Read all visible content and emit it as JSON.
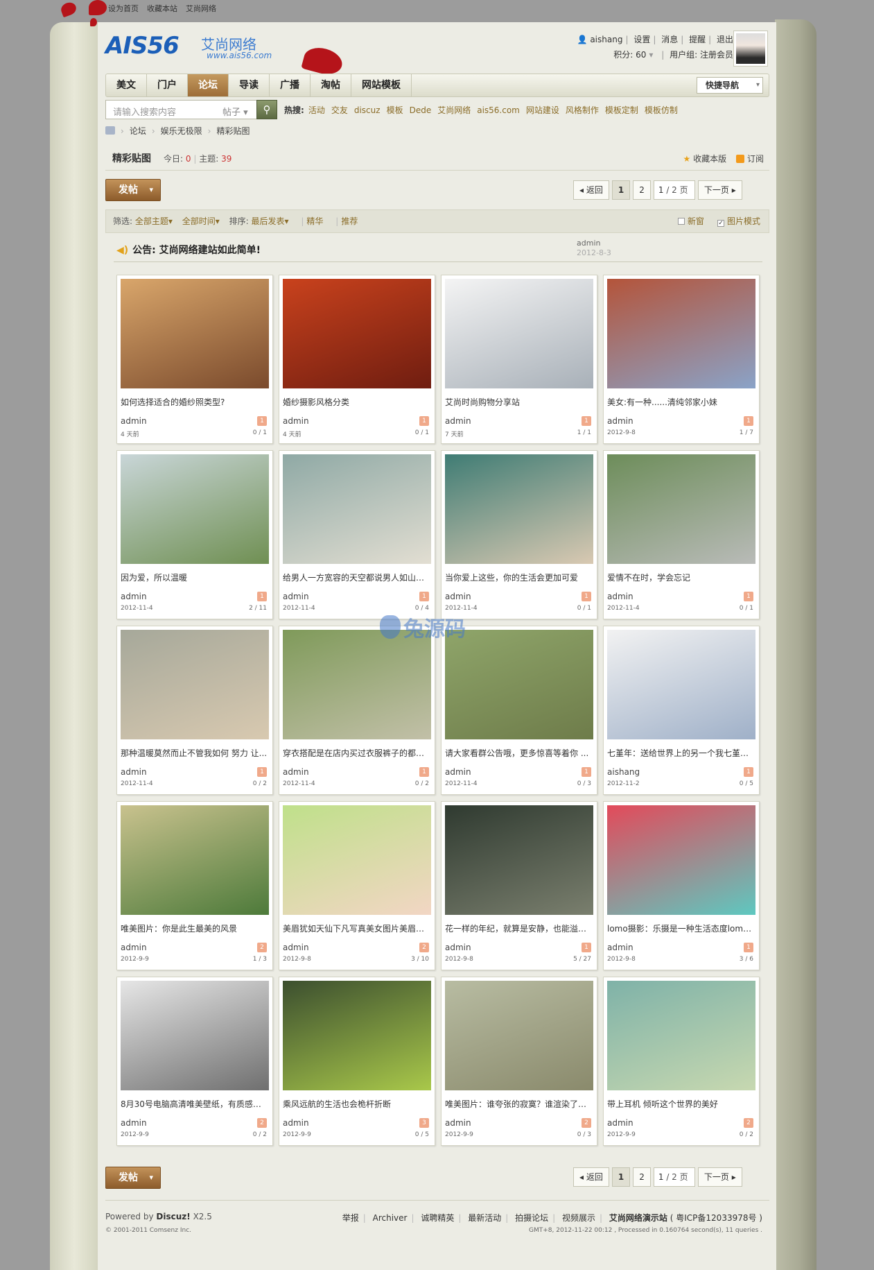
{
  "topbar": {
    "links": [
      "设为首页",
      "收藏本站",
      "艾尚网络"
    ]
  },
  "logo": {
    "mark": "AIS56",
    "cn": "艾尚网络",
    "url": "www.ais56.com"
  },
  "user": {
    "name": "aishang",
    "links": [
      "设置",
      "消息",
      "提醒",
      "退出"
    ],
    "points": "积分: 60",
    "group": "用户组: 注册会员"
  },
  "nav": {
    "items": [
      "美文",
      "门户",
      "论坛",
      "导读",
      "广播",
      "淘帖",
      "网站模板"
    ],
    "active": 2,
    "quick": "快捷导航"
  },
  "search": {
    "placeholder": "请输入搜索内容",
    "type": "帖子"
  },
  "hot": {
    "label": "热搜:",
    "items": [
      "活动",
      "交友",
      "discuz",
      "模板",
      "Dede",
      "艾尚网络",
      "ais56.com",
      "网站建设",
      "风格制作",
      "模板定制",
      "模板仿制"
    ]
  },
  "breadcrumb": [
    "论坛",
    "娱乐无极限",
    "精彩贴图"
  ],
  "forum": {
    "name": "精彩贴图",
    "today_label": "今日:",
    "today": "0",
    "topics_label": "主题:",
    "topics": "39",
    "fav": "收藏本版",
    "rss": "订阅"
  },
  "post_label": "发帖",
  "pager": {
    "back": "返回",
    "pages": [
      "1",
      "2"
    ],
    "input": "1",
    "total": "/ 2 页",
    "next": "下一页"
  },
  "filter": {
    "label": "筛选:",
    "opts": [
      "全部主题",
      "全部时间"
    ],
    "sort_label": "排序:",
    "sort": "最后发表",
    "digest": "精华",
    "recommend": "推荐",
    "newwin": "新窗",
    "picmode": "图片模式"
  },
  "notice": {
    "title": "公告: 艾尚网络建站如此简单!",
    "author": "admin",
    "date": "2012-8-3"
  },
  "colors": {
    "active_tab": "#9d6d38",
    "link": "#8a6c28",
    "badge": "#f0a98a"
  },
  "posts": [
    {
      "t": "如何选择适合的婚纱照类型?",
      "au": "admin",
      "dt": "4 天前",
      "b": "1",
      "rv": "0 / 1",
      "c1": "#d9a66b",
      "c2": "#7a4a2c"
    },
    {
      "t": "婚纱摄影风格分类",
      "au": "admin",
      "dt": "4 天前",
      "b": "1",
      "rv": "0 / 1",
      "c1": "#c9421d",
      "c2": "#6f1d10"
    },
    {
      "t": "艾尚时尚购物分享站",
      "au": "admin",
      "dt": "7 天前",
      "b": "1",
      "rv": "1 / 1",
      "c1": "#f4f4f4",
      "c2": "#a8b0b8"
    },
    {
      "t": "美女:有一种......清纯邻家小妹",
      "au": "admin",
      "dt": "2012-9-8",
      "b": "1",
      "rv": "1 / 7",
      "c1": "#b4543a",
      "c2": "#8aa3c8"
    },
    {
      "t": "因为爱，所以温暖",
      "au": "admin",
      "dt": "2012-11-4",
      "b": "1",
      "rv": "2 / 11",
      "c1": "#c9d6d8",
      "c2": "#6f8f52"
    },
    {
      "t": "给男人一方宽容的天空都说男人如山般...",
      "au": "admin",
      "dt": "2012-11-4",
      "b": "1",
      "rv": "0 / 4",
      "c1": "#8fa9a5",
      "c2": "#e2ded2"
    },
    {
      "t": "当你爱上这些，你的生活会更加可爱",
      "au": "admin",
      "dt": "2012-11-4",
      "b": "1",
      "rv": "0 / 1",
      "c1": "#3f7c74",
      "c2": "#d9c9b2"
    },
    {
      "t": "爱情不在时，学会忘记",
      "au": "admin",
      "dt": "2012-11-4",
      "b": "1",
      "rv": "0 / 1",
      "c1": "#6d8d5a",
      "c2": "#b9bbb8"
    },
    {
      "t": "那种温暖莫然而止不管我如何 努力 让...",
      "au": "admin",
      "dt": "2012-11-4",
      "b": "1",
      "rv": "0 / 2",
      "c1": "#a6a89a",
      "c2": "#d8c9b0"
    },
    {
      "t": "穿衣搭配是在店内买过衣服裤子的都可...",
      "au": "admin",
      "dt": "2012-11-4",
      "b": "1",
      "rv": "0 / 2",
      "c1": "#7f9a5a",
      "c2": "#c2c0a8"
    },
    {
      "t": "请大家看群公告哦，更多惊喜等着你 ...",
      "au": "admin",
      "dt": "2012-11-4",
      "b": "1",
      "rv": "0 / 3",
      "c1": "#8fa56a",
      "c2": "#6e7c4a"
    },
    {
      "t": "七堇年：送给世界上的另一个我七堇年...",
      "au": "aishang",
      "dt": "2012-11-2",
      "b": "1",
      "rv": "0 / 5",
      "c1": "#f2f2f2",
      "c2": "#9fb0c8"
    },
    {
      "t": "唯美图片：你是此生最美的风景",
      "au": "admin",
      "dt": "2012-9-9",
      "b": "2",
      "rv": "1 / 3",
      "c1": "#c9c28e",
      "c2": "#4d7a3a"
    },
    {
      "t": "美眉犹如天仙下凡写真美女图片美眉犹...",
      "au": "admin",
      "dt": "2012-9-8",
      "b": "2",
      "rv": "3 / 10",
      "c1": "#bfe08a",
      "c2": "#f2d6c4"
    },
    {
      "t": "花一样的年纪，就算是安静，也能溢出...",
      "au": "admin",
      "dt": "2012-9-8",
      "b": "1",
      "rv": "5 / 27",
      "c1": "#2f3a30",
      "c2": "#7a7f6e"
    },
    {
      "t": "lomo摄影：乐摄是一种生活态度lomo...",
      "au": "admin",
      "dt": "2012-9-8",
      "b": "1",
      "rv": "3 / 6",
      "c1": "#e34a5a",
      "c2": "#5ec8c0"
    },
    {
      "t": "8月30号电脑高清唯美壁纸，有质感的...",
      "au": "admin",
      "dt": "2012-9-9",
      "b": "2",
      "rv": "0 / 2",
      "c1": "#e6e6e6",
      "c2": "#6f6f6f"
    },
    {
      "t": "乘风远航的生活也会桅杆折断",
      "au": "admin",
      "dt": "2012-9-9",
      "b": "3",
      "rv": "0 / 5",
      "c1": "#3c4f2f",
      "c2": "#a9c84a"
    },
    {
      "t": "唯美图片：谁夸张的寂寞？谁渲染了年...",
      "au": "admin",
      "dt": "2012-9-9",
      "b": "2",
      "rv": "0 / 3",
      "c1": "#b8bca2",
      "c2": "#8a8a6c"
    },
    {
      "t": "带上耳机 倾听这个世界的美好",
      "au": "admin",
      "dt": "2012-9-9",
      "b": "2",
      "rv": "0 / 2",
      "c1": "#7fb2a8",
      "c2": "#c7d8b0"
    }
  ],
  "footer": {
    "powered": "Powered by",
    "brand": "Discuz!",
    "ver": "X2.5",
    "copyright": "© 2001-2011 Comsenz Inc.",
    "links": [
      "举报",
      "Archiver",
      "诚聘精英",
      "最新活动",
      "拍摄论坛",
      "视频展示",
      "艾尚网络演示站",
      "( 粤ICP备12033978号 )"
    ],
    "proc": "GMT+8, 2012-11-22 00:12 , Processed in 0.160764 second(s), 11 queries ."
  },
  "watermark": "兔源码"
}
